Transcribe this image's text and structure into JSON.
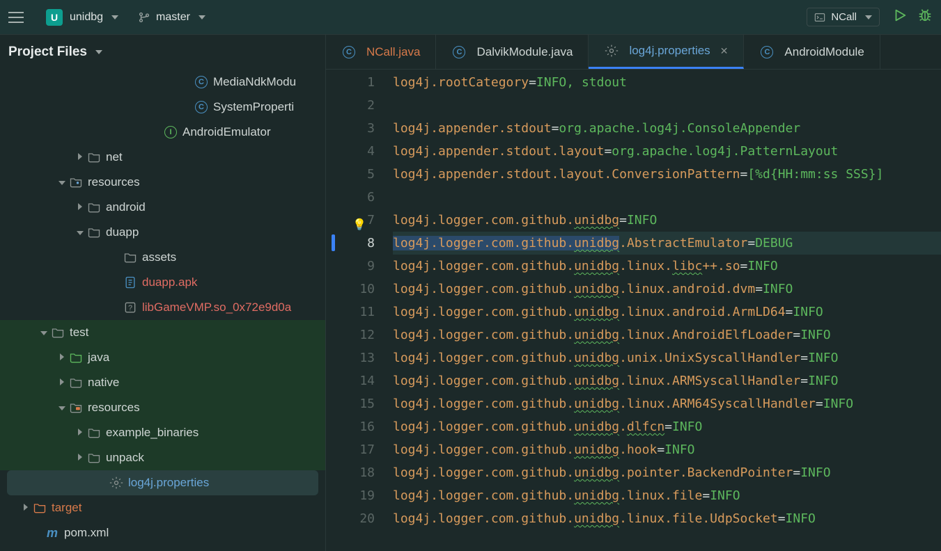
{
  "toolbar": {
    "project_letter": "U",
    "project_name": "unidbg",
    "branch_name": "master",
    "run_config": "NCall"
  },
  "sidebar": {
    "title": "Project Files",
    "items": [
      {
        "indent": 260,
        "twist": "",
        "icon": "circle-c",
        "label": "MediaNdkModu",
        "cls": ""
      },
      {
        "indent": 260,
        "twist": "",
        "icon": "circle-c",
        "label": "SystemProperti",
        "cls": ""
      },
      {
        "indent": 216,
        "twist": "",
        "icon": "circle-i",
        "label": "AndroidEmulator",
        "cls": ""
      },
      {
        "indent": 106,
        "twist": "right",
        "icon": "folder",
        "label": "net",
        "cls": ""
      },
      {
        "indent": 80,
        "twist": "down",
        "icon": "folder-dot",
        "label": "resources",
        "cls": ""
      },
      {
        "indent": 106,
        "twist": "right",
        "icon": "folder",
        "label": "android",
        "cls": ""
      },
      {
        "indent": 106,
        "twist": "down",
        "icon": "folder",
        "label": "duapp",
        "cls": ""
      },
      {
        "indent": 158,
        "twist": "",
        "icon": "folder",
        "label": "assets",
        "cls": ""
      },
      {
        "indent": 158,
        "twist": "",
        "icon": "apk",
        "label": "duapp.apk",
        "cls": "red"
      },
      {
        "indent": 158,
        "twist": "",
        "icon": "q",
        "label": "libGameVMP.so_0x72e9d0a",
        "cls": "red"
      },
      {
        "indent": 54,
        "twist": "down",
        "icon": "folder",
        "label": "test",
        "cls": "",
        "row": "hl-green"
      },
      {
        "indent": 80,
        "twist": "right",
        "icon": "folder-green",
        "label": "java",
        "cls": "",
        "row": "hl-green"
      },
      {
        "indent": 80,
        "twist": "right",
        "icon": "folder",
        "label": "native",
        "cls": "",
        "row": "hl-green"
      },
      {
        "indent": 80,
        "twist": "down",
        "icon": "folder-res",
        "label": "resources",
        "cls": "",
        "row": "hl-green"
      },
      {
        "indent": 106,
        "twist": "right",
        "icon": "folder",
        "label": "example_binaries",
        "cls": "",
        "row": "hl-green"
      },
      {
        "indent": 106,
        "twist": "right",
        "icon": "folder",
        "label": "unpack",
        "cls": "",
        "row": "hl-green"
      },
      {
        "indent": 128,
        "twist": "",
        "icon": "gear",
        "label": "log4j.properties",
        "cls": "blue",
        "row": "selected"
      },
      {
        "indent": 28,
        "twist": "right",
        "icon": "folder-orange",
        "label": "target",
        "cls": "orange"
      },
      {
        "indent": 46,
        "twist": "",
        "icon": "m",
        "label": "pom.xml",
        "cls": ""
      }
    ]
  },
  "tabs": [
    {
      "icon": "circle-c",
      "label": "NCall.java",
      "cls": "orange",
      "close": false
    },
    {
      "icon": "circle-c",
      "label": "DalvikModule.java",
      "cls": "",
      "close": false
    },
    {
      "icon": "gear",
      "label": "log4j.properties",
      "cls": "blue",
      "close": true,
      "active": true
    },
    {
      "icon": "circle-c",
      "label": "AndroidModule",
      "cls": "",
      "close": false
    }
  ],
  "code": {
    "current_line": 8,
    "lines": [
      {
        "n": 1,
        "k": "log4j.rootCategory",
        "eq": "=",
        "v": "INFO, stdout"
      },
      {
        "n": 2,
        "blank": true
      },
      {
        "n": 3,
        "k": "log4j.appender.stdout",
        "eq": "=",
        "v": "org.apache.log4j.ConsoleAppender"
      },
      {
        "n": 4,
        "k": "log4j.appender.stdout.layout",
        "eq": "=",
        "v": "org.apache.log4j.PatternLayout"
      },
      {
        "n": 5,
        "k": "log4j.appender.stdout.layout.ConversionPattern",
        "eq": "=",
        "v": "[%d{HH:mm:ss SSS}]"
      },
      {
        "n": 6,
        "blank": true
      },
      {
        "n": 7,
        "k": "log4j.logger.com.github.",
        "w": "unidbg",
        "eq": "=",
        "v": "INFO",
        "bulb": true
      },
      {
        "n": 8,
        "selkey": "log4j.logger.com.github.",
        "selw": "unidbg",
        "post": ".AbstractEmulator",
        "eq": "=",
        "v": "DEBUG",
        "current": true
      },
      {
        "n": 9,
        "k": "log4j.logger.com.github.",
        "w": "unidbg",
        "k2": ".linux.",
        "w2": "libc",
        "k3": "++.so",
        "eq": "=",
        "v": "INFO"
      },
      {
        "n": 10,
        "k": "log4j.logger.com.github.",
        "w": "unidbg",
        "k2": ".linux.android.dvm",
        "eq": "=",
        "v": "INFO"
      },
      {
        "n": 11,
        "k": "log4j.logger.com.github.",
        "w": "unidbg",
        "k2": ".linux.android.ArmLD64",
        "eq": "=",
        "v": "INFO"
      },
      {
        "n": 12,
        "k": "log4j.logger.com.github.",
        "w": "unidbg",
        "k2": ".linux.AndroidElfLoader",
        "eq": "=",
        "v": "INFO"
      },
      {
        "n": 13,
        "k": "log4j.logger.com.github.",
        "w": "unidbg",
        "k2": ".unix.UnixSyscallHandler",
        "eq": "=",
        "v": "INFO"
      },
      {
        "n": 14,
        "k": "log4j.logger.com.github.",
        "w": "unidbg",
        "k2": ".linux.ARMSyscallHandler",
        "eq": "=",
        "v": "INFO"
      },
      {
        "n": 15,
        "k": "log4j.logger.com.github.",
        "w": "unidbg",
        "k2": ".linux.ARM64SyscallHandler",
        "eq": "=",
        "v": "INFO"
      },
      {
        "n": 16,
        "k": "log4j.logger.com.github.",
        "w": "unidbg",
        "k2": ".",
        "w2": "dlfcn",
        "eq": "=",
        "v": "INFO"
      },
      {
        "n": 17,
        "k": "log4j.logger.com.github.",
        "w": "unidbg",
        "k2": ".hook",
        "eq": "=",
        "v": "INFO"
      },
      {
        "n": 18,
        "k": "log4j.logger.com.github.",
        "w": "unidbg",
        "k2": ".pointer.BackendPointer",
        "eq": "=",
        "v": "INFO"
      },
      {
        "n": 19,
        "k": "log4j.logger.com.github.",
        "w": "unidbg",
        "k2": ".linux.file",
        "eq": "=",
        "v": "INFO"
      },
      {
        "n": 20,
        "k": "log4j.logger.com.github.",
        "w": "unidbg",
        "k2": ".linux.file.UdpSocket",
        "eq": "=",
        "v": "INFO"
      }
    ]
  }
}
